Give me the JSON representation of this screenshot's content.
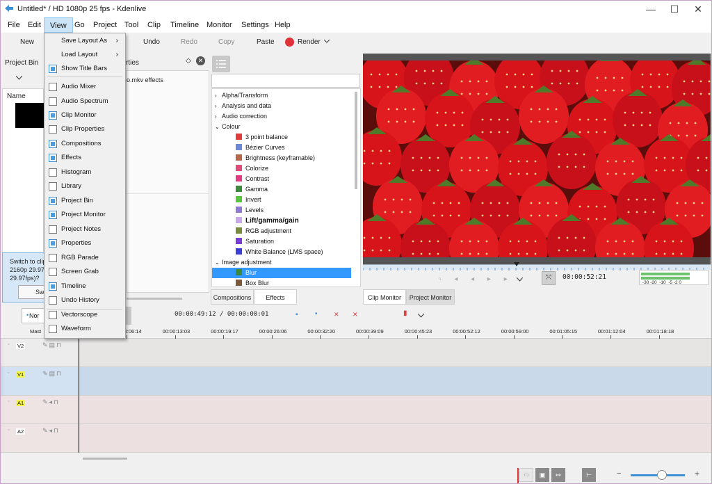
{
  "window": {
    "title": "Untitled* / HD 1080p 25 fps - Kdenlive",
    "minimize": "—",
    "maximize": "☐",
    "close": "✕"
  },
  "menu": [
    "File",
    "Edit",
    "View",
    "Go",
    "Project",
    "Tool",
    "Clip",
    "Timeline",
    "Monitor",
    "Settings",
    "Help"
  ],
  "toolbar": {
    "new": "New",
    "undo": "Undo",
    "redo": "Redo",
    "copy": "Copy",
    "paste": "Paste",
    "render": "Render",
    "render_color": "#e0303a"
  },
  "view_menu": [
    {
      "label": "Save Layout As",
      "type": "submenu"
    },
    {
      "label": "Load Layout",
      "type": "submenu"
    },
    {
      "label": "Show Title Bars",
      "type": "check",
      "checked": true
    },
    {
      "label": "Audio Mixer",
      "type": "check",
      "checked": false
    },
    {
      "label": "Audio Spectrum",
      "type": "check",
      "checked": false
    },
    {
      "label": "Clip Monitor",
      "type": "check",
      "checked": true
    },
    {
      "label": "Clip Properties",
      "type": "check",
      "checked": false
    },
    {
      "label": "Compositions",
      "type": "check",
      "checked": true
    },
    {
      "label": "Effects",
      "type": "check",
      "checked": true
    },
    {
      "label": "Histogram",
      "type": "check",
      "checked": false
    },
    {
      "label": "Library",
      "type": "check",
      "checked": false
    },
    {
      "label": "Project Bin",
      "type": "check",
      "checked": true
    },
    {
      "label": "Project Monitor",
      "type": "check",
      "checked": true
    },
    {
      "label": "Project Notes",
      "type": "check",
      "checked": false
    },
    {
      "label": "Properties",
      "type": "check",
      "checked": true
    },
    {
      "label": "RGB Parade",
      "type": "check",
      "checked": false
    },
    {
      "label": "Screen Grab",
      "type": "check",
      "checked": false
    },
    {
      "label": "Timeline",
      "type": "check",
      "checked": true
    },
    {
      "label": "Undo History",
      "type": "check",
      "checked": false
    },
    {
      "label": "Vectorscope",
      "type": "check",
      "checked": false
    },
    {
      "label": "Waveform",
      "type": "check",
      "checked": false
    }
  ],
  "project_bin": {
    "title": "Project Bin",
    "column_name": "Name",
    "notice": "Switch to clip\n2160p 29.97\n29.97fps)?",
    "switch_btn": "Swi"
  },
  "properties": {
    "title": "rties",
    "subtitle": "o.mkv effects"
  },
  "effects": {
    "categories": [
      {
        "label": "Alpha/Transform",
        "open": false
      },
      {
        "label": "Analysis and data",
        "open": false
      },
      {
        "label": "Audio correction",
        "open": false
      },
      {
        "label": "Colour",
        "open": true
      }
    ],
    "colour_items": [
      {
        "label": "3 point balance",
        "color": "#e23b3b",
        "bold": false
      },
      {
        "label": "Bézier Curves",
        "color": "#6f88d6",
        "bold": false
      },
      {
        "label": "Brightness (keyframable)",
        "color": "#b5694a",
        "bold": false
      },
      {
        "label": "Colorize",
        "color": "#e24a7a",
        "bold": false
      },
      {
        "label": "Contrast",
        "color": "#e23b7f",
        "bold": false
      },
      {
        "label": "Gamma",
        "color": "#3c8a3c",
        "bold": false
      },
      {
        "label": "Invert",
        "color": "#56c43c",
        "bold": false
      },
      {
        "label": "Levels",
        "color": "#8f7ad0",
        "bold": false
      },
      {
        "label": "Lift/gamma/gain",
        "color": "#c8a8e8",
        "bold": true
      },
      {
        "label": "RGB adjustment",
        "color": "#7a8a3c",
        "bold": false
      },
      {
        "label": "Saturation",
        "color": "#7a3cd6",
        "bold": false
      },
      {
        "label": "White Balance (LMS space)",
        "color": "#3c3cd6",
        "bold": false
      }
    ],
    "category2": "Image adjustment",
    "image_items": [
      {
        "label": "Blur",
        "color": "#3c8a3c",
        "selected": true
      },
      {
        "label": "Box Blur",
        "color": "#7a5a3a",
        "selected": false
      }
    ]
  },
  "bottom_tabs_left": [
    "Compositions",
    "Effects"
  ],
  "monitor_tabs": [
    "Clip Monitor",
    "Project Monitor"
  ],
  "monitor": {
    "timecode": "00:00:52:21",
    "meter_labels": "-30 -20  -10  -5 -2 0"
  },
  "timeline_toolbar": {
    "mode": "Nor",
    "timecode": "00:00:49:12 / 00:00:00:01"
  },
  "ruler": {
    "master": "Mast",
    "ticks": [
      "00:00:06:14",
      "00:00:13:03",
      "00:00:19:17",
      "00:00:26:06",
      "00:00:32:20",
      "00:00:39:09",
      "00:00:45:23",
      "00:00:52:12",
      "00:00:59:00",
      "00:01:05:15",
      "00:01:12:04",
      "00:01:18:18"
    ]
  },
  "tracks": [
    {
      "name": "V2",
      "kind": "video",
      "bg": "#e7e4e4",
      "label_bg": "#ffffff"
    },
    {
      "name": "V1",
      "kind": "video",
      "bg": "#c9d9ea",
      "label_bg": "#f3f34a"
    },
    {
      "name": "A1",
      "kind": "audio",
      "bg": "#ece0e0",
      "label_bg": "#f3f34a"
    },
    {
      "name": "A2",
      "kind": "audio",
      "bg": "#ece0e0",
      "label_bg": "#ffffff"
    }
  ]
}
